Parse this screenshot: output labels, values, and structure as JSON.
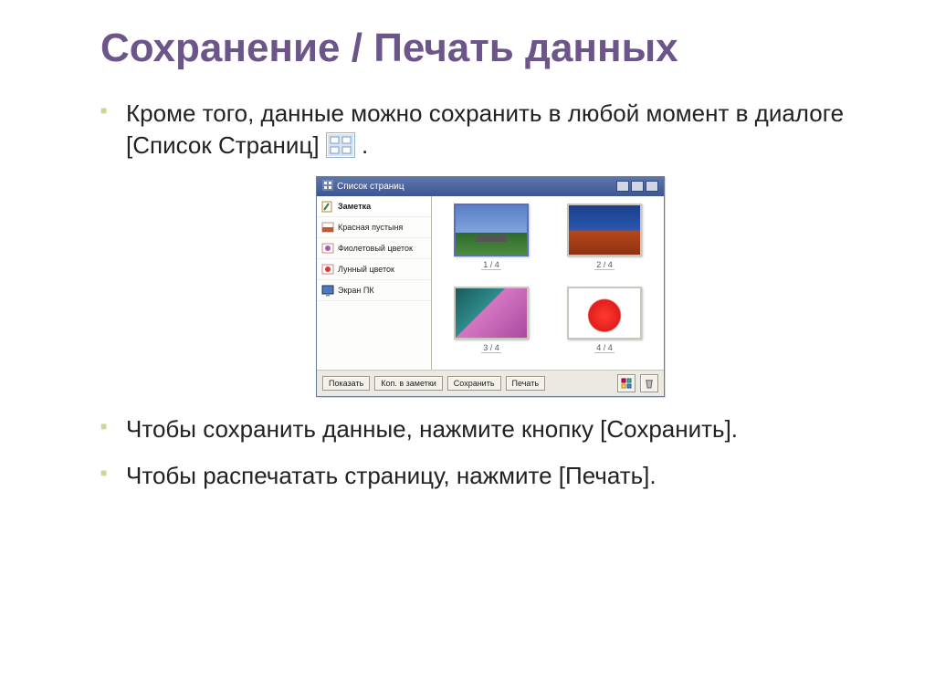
{
  "title": "Сохранение / Печать данных",
  "bullets": {
    "b1a": "Кроме того, данные можно сохранить в любой момент в диалоге [Список Страниц] ",
    "b1b": " .",
    "b2": "Чтобы сохранить данные, нажмите кнопку [Сохранить].",
    "b3": "Чтобы распечатать страницу, нажмите [Печать]."
  },
  "dialog": {
    "title": "Список страниц",
    "sidebar": [
      "Заметка",
      "Красная пустыня",
      "Фиолетовый цветок",
      "Лунный цветок",
      "Экран ПК"
    ],
    "thumbs": [
      "1 / 4",
      "2 / 4",
      "3 / 4",
      "4 / 4"
    ],
    "buttons": {
      "show": "Показать",
      "copy": "Коп. в заметки",
      "save": "Сохранить",
      "print": "Печать"
    }
  }
}
